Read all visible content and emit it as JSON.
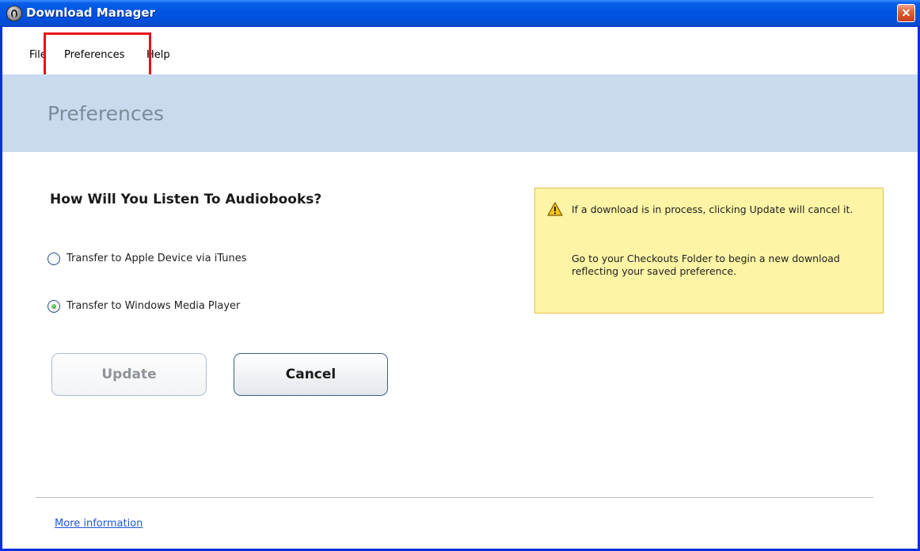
{
  "window": {
    "title": "Download Manager"
  },
  "menu": {
    "file": "File",
    "preferences": "Preferences",
    "help": "Help"
  },
  "header": {
    "title": "Preferences"
  },
  "main": {
    "question": "How Will You Listen To Audiobooks?",
    "options": [
      {
        "label": "Transfer to Apple Device via iTunes",
        "selected": false
      },
      {
        "label": "Transfer to Windows Media Player",
        "selected": true
      }
    ],
    "update_label": "Update",
    "update_enabled": false,
    "cancel_label": "Cancel"
  },
  "notice": {
    "line1": "If a download is in process, clicking Update will cancel it.",
    "line2": "Go to your Checkouts Folder to begin a new download reflecting your saved preference.",
    "icon": "warning-icon"
  },
  "footer": {
    "more_info": "More information"
  },
  "colors": {
    "titlebar": "#0054e3",
    "header_band": "#c9daef",
    "notice_bg": "#fdf4a5",
    "highlight": "#e8101a",
    "link": "#1f56d6"
  }
}
